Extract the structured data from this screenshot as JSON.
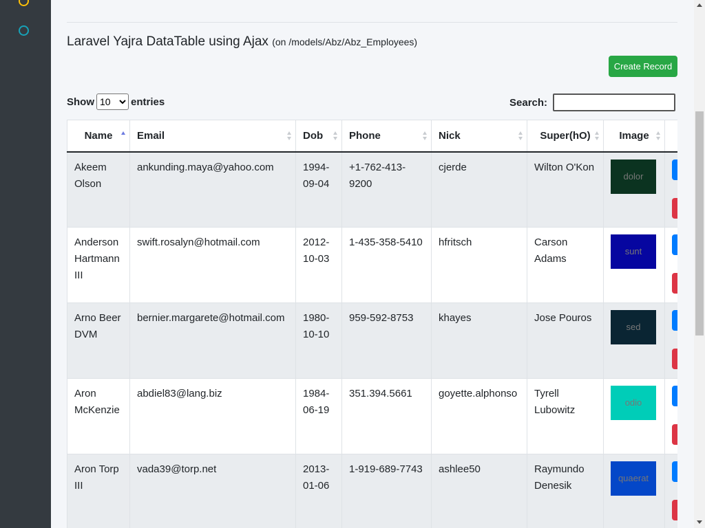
{
  "sidebar": {
    "icons": [
      {
        "name": "circle-icon-yellow",
        "color": "#ffc107"
      },
      {
        "name": "circle-icon-teal",
        "color": "#17a2b8"
      }
    ]
  },
  "page": {
    "title": "Laravel Yajra DataTable using Ajax",
    "subtitle": "(on /models/Abz/Abz_Employees)",
    "create_button": "Create Record"
  },
  "controls": {
    "show_label": "Show",
    "entries_label": "entries",
    "length_value": "10",
    "search_label": "Search:",
    "search_value": ""
  },
  "table": {
    "columns": [
      "Name",
      "Email",
      "Dob",
      "Phone",
      "Nick",
      "Super(hO)",
      "Image"
    ],
    "sorted_column": "Name",
    "sort_direction": "asc",
    "rows": [
      {
        "name": "Akeem Olson",
        "email": "ankunding.maya@yahoo.com",
        "dob": "1994-09-04",
        "phone": "+1-762-413-9200",
        "nick": "cjerde",
        "super": "Wilton O'Kon",
        "image_text": "dolor",
        "image_color": "#0b3320"
      },
      {
        "name": "Anderson Hartmann III",
        "email": "swift.rosalyn@hotmail.com",
        "dob": "2012-10-03",
        "phone": "1-435-358-5410",
        "nick": "hfritsch",
        "super": "Carson Adams",
        "image_text": "sunt",
        "image_color": "#0606a0"
      },
      {
        "name": "Arno Beer DVM",
        "email": "bernier.margarete@hotmail.com",
        "dob": "1980-10-10",
        "phone": "959-592-8753",
        "nick": "khayes",
        "super": "Jose Pouros",
        "image_text": "sed",
        "image_color": "#0a2533"
      },
      {
        "name": "Aron McKenzie",
        "email": "abdiel83@lang.biz",
        "dob": "1984-06-19",
        "phone": "351.394.5661",
        "nick": "goyette.alphonso",
        "super": "Tyrell Lubowitz",
        "image_text": "odio",
        "image_color": "#00cdb8"
      },
      {
        "name": "Aron Torp III",
        "email": "vada39@torp.net",
        "dob": "2013-01-06",
        "phone": "1-919-689-7743",
        "nick": "ashlee50",
        "super": "Raymundo Denesik",
        "image_text": "quaerat",
        "image_color": "#0447c8"
      }
    ]
  },
  "colors": {
    "sidebar_bg": "#343a40",
    "create_button": "#28a745",
    "edit_button": "#007bff",
    "delete_button": "#dc3545"
  }
}
